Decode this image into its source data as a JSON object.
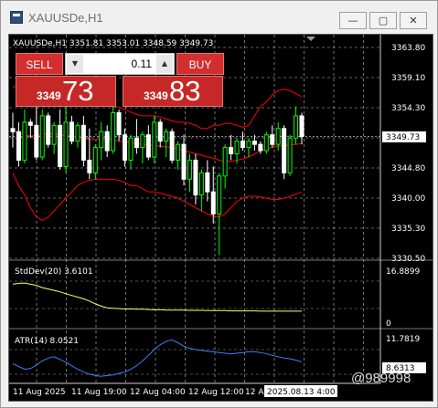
{
  "window": {
    "title": "XAUUSDe,H1",
    "min_glyph": "—",
    "max_glyph": "▢",
    "close_glyph": "✕"
  },
  "chart_header": "XAUUSDe,H1  3351.81 3353.01 3348.59 3349.73",
  "trade_panel": {
    "sell_label": "SELL",
    "buy_label": "BUY",
    "lot_value": "0.11",
    "bid_prefix": "3349",
    "bid_big": "73",
    "ask_prefix": "3349",
    "ask_big": "83"
  },
  "price_axis": [
    "3363.80",
    "3359.10",
    "3354.30",
    "3349.60",
    "3344.80",
    "3340.00",
    "3335.30",
    "3330.50"
  ],
  "current_price": "3349.73",
  "stddev": {
    "label": "StdDev(20) 3.6101",
    "max_label": "16.8899",
    "min_label": "0"
  },
  "atr": {
    "label": "ATR(14) 8.0521",
    "max_label": "11.7819",
    "current_label": "8.6313"
  },
  "time_axis": [
    "11 Aug 2025",
    "11 Aug 19:00",
    "12 Aug 04:00",
    "12 Aug 12:00",
    "12 Aug 20:00"
  ],
  "time_cursor_label": "2025.08.13 4:00",
  "watermark": "@989998",
  "colors": {
    "bull": "#00ff00",
    "bear": "#ffffff",
    "band": "#ff0000",
    "stddev": "#ffff66",
    "atr": "#3b82f6",
    "grid": "#ffffff",
    "panel_red": "#d32f2f"
  },
  "chart_data": {
    "type": "candlestick",
    "title": "XAUUSDe,H1",
    "ylim": [
      3330.5,
      3363.8
    ],
    "ohlc": [
      [
        3351.0,
        3353.5,
        3348.0,
        3350.5
      ],
      [
        3350.5,
        3352.0,
        3345.0,
        3346.0
      ],
      [
        3346.0,
        3354.0,
        3345.5,
        3352.0
      ],
      [
        3352.0,
        3352.5,
        3349.5,
        3351.5
      ],
      [
        3351.5,
        3355.0,
        3346.0,
        3346.5
      ],
      [
        3346.5,
        3354.0,
        3346.0,
        3353.0
      ],
      [
        3353.0,
        3353.5,
        3348.0,
        3348.5
      ],
      [
        3348.5,
        3352.0,
        3347.0,
        3351.5
      ],
      [
        3351.5,
        3354.0,
        3344.5,
        3345.0
      ],
      [
        3345.0,
        3354.5,
        3344.0,
        3352.0
      ],
      [
        3352.0,
        3353.0,
        3348.5,
        3349.0
      ],
      [
        3349.0,
        3352.0,
        3348.0,
        3351.5
      ],
      [
        3351.5,
        3353.0,
        3345.0,
        3346.0
      ],
      [
        3346.0,
        3351.0,
        3343.0,
        3344.0
      ],
      [
        3344.0,
        3348.5,
        3343.0,
        3348.0
      ],
      [
        3348.0,
        3352.0,
        3346.0,
        3350.5
      ],
      [
        3350.5,
        3351.5,
        3346.5,
        3347.5
      ],
      [
        3347.5,
        3354.5,
        3347.0,
        3353.5
      ],
      [
        3353.5,
        3354.0,
        3349.0,
        3350.0
      ],
      [
        3350.0,
        3351.0,
        3345.0,
        3346.0
      ],
      [
        3346.0,
        3350.0,
        3344.5,
        3349.5
      ],
      [
        3349.5,
        3352.5,
        3347.0,
        3348.0
      ],
      [
        3348.0,
        3350.5,
        3345.5,
        3350.0
      ],
      [
        3350.0,
        3351.5,
        3346.0,
        3346.5
      ],
      [
        3346.5,
        3353.0,
        3345.5,
        3352.0
      ],
      [
        3352.0,
        3352.5,
        3348.0,
        3349.0
      ],
      [
        3349.0,
        3351.0,
        3346.5,
        3350.5
      ],
      [
        3350.5,
        3351.0,
        3345.5,
        3346.0
      ],
      [
        3346.0,
        3349.0,
        3344.5,
        3348.5
      ],
      [
        3348.5,
        3350.0,
        3342.0,
        3343.0
      ],
      [
        3343.0,
        3347.0,
        3341.0,
        3346.0
      ],
      [
        3346.0,
        3347.0,
        3339.0,
        3340.5
      ],
      [
        3340.5,
        3344.5,
        3338.0,
        3344.0
      ],
      [
        3344.0,
        3346.0,
        3339.5,
        3341.0
      ],
      [
        3341.0,
        3345.0,
        3336.0,
        3337.5
      ],
      [
        3337.5,
        3344.0,
        3331.0,
        3343.5
      ],
      [
        3343.5,
        3348.5,
        3341.5,
        3348.0
      ],
      [
        3348.0,
        3350.0,
        3346.0,
        3347.0
      ],
      [
        3347.0,
        3349.5,
        3345.5,
        3349.0
      ],
      [
        3349.0,
        3350.5,
        3347.5,
        3348.0
      ],
      [
        3348.0,
        3349.5,
        3346.5,
        3349.0
      ],
      [
        3349.0,
        3350.0,
        3347.5,
        3348.5
      ],
      [
        3348.5,
        3349.0,
        3347.0,
        3347.5
      ],
      [
        3347.5,
        3350.5,
        3347.0,
        3350.0
      ],
      [
        3350.0,
        3351.5,
        3348.0,
        3348.5
      ],
      [
        3348.5,
        3352.0,
        3347.5,
        3351.0
      ],
      [
        3351.0,
        3351.5,
        3343.0,
        3344.0
      ],
      [
        3344.0,
        3350.0,
        3343.5,
        3349.5
      ],
      [
        3349.5,
        3354.5,
        3348.5,
        3353.0
      ],
      [
        3353.0,
        3353.5,
        3348.5,
        3349.73
      ]
    ],
    "bands": {
      "upper": [
        3357.5,
        3357.8,
        3358.2,
        3358.0,
        3357.8,
        3357.6,
        3357.5,
        3357.2,
        3357.0,
        3356.8,
        3356.5,
        3356.3,
        3356.0,
        3355.8,
        3355.5,
        3355.0,
        3354.5,
        3354.5,
        3354.4,
        3354.0,
        3353.6,
        3353.2,
        3353.0,
        3353.0,
        3353.0,
        3352.8,
        3352.5,
        3352.2,
        3352.0,
        3352.0,
        3351.8,
        3351.5,
        3351.0,
        3351.0,
        3351.5,
        3351.5,
        3351.8,
        3351.8,
        3351.5,
        3351.2,
        3351.5,
        3353.0,
        3354.5,
        3355.2,
        3356.3,
        3357.0,
        3357.2,
        3357.0,
        3356.5,
        3356.0
      ],
      "middle": [
        3350.5,
        3350.3,
        3350.0,
        3349.8,
        3349.9,
        3350.0,
        3350.2,
        3350.1,
        3350.0,
        3349.9,
        3349.8,
        3349.7,
        3349.5,
        3349.3,
        3349.2,
        3349.3,
        3349.3,
        3349.2,
        3349.0,
        3348.9,
        3348.8,
        3348.6,
        3348.5,
        3348.4,
        3348.3,
        3348.2,
        3348.1,
        3348.0,
        3347.8,
        3347.5,
        3347.3,
        3347.0,
        3346.8,
        3346.5,
        3346.3,
        3346.0,
        3345.8,
        3345.8,
        3346.0,
        3346.2,
        3346.5,
        3347.0,
        3347.5,
        3347.8,
        3348.0,
        3348.2,
        3348.3,
        3348.4,
        3348.5,
        3348.6
      ],
      "lower": [
        3344.0,
        3342.0,
        3340.5,
        3338.5,
        3337.0,
        3336.5,
        3337.0,
        3338.0,
        3339.0,
        3340.0,
        3341.0,
        3342.0,
        3342.5,
        3342.8,
        3343.0,
        3343.0,
        3343.0,
        3343.0,
        3342.8,
        3342.5,
        3342.0,
        3342.0,
        3341.5,
        3341.0,
        3341.0,
        3340.8,
        3340.5,
        3340.3,
        3340.0,
        3339.5,
        3339.0,
        3338.5,
        3338.0,
        3337.5,
        3337.2,
        3337.0,
        3337.5,
        3338.5,
        3339.5,
        3340.0,
        3340.3,
        3340.3,
        3340.2,
        3340.0,
        3339.8,
        3339.8,
        3340.0,
        3340.3,
        3340.6,
        3341.0
      ]
    },
    "stddev_series": {
      "name": "StdDev(20)",
      "ylim": [
        0,
        16.8899
      ],
      "values": [
        13.2,
        13.5,
        13.6,
        13.2,
        12.8,
        12.0,
        11.5,
        11.0,
        10.5,
        9.8,
        9.2,
        8.6,
        8.0,
        7.2,
        6.2,
        5.4,
        4.8,
        4.6,
        4.5,
        4.4,
        4.4,
        4.3,
        4.3,
        4.2,
        4.1,
        4.1,
        4.0,
        4.0,
        4.0,
        4.0,
        3.9,
        3.9,
        3.9,
        3.8,
        3.8,
        3.8,
        3.8,
        3.7,
        3.7,
        3.7,
        3.7,
        3.7,
        3.6,
        3.6,
        3.6,
        3.6,
        3.6,
        3.6,
        3.6,
        3.61
      ]
    },
    "atr_series": {
      "name": "ATR(14)",
      "ylim": [
        5.5,
        11.7819
      ],
      "values": [
        7.8,
        7.4,
        7.0,
        7.1,
        7.6,
        8.2,
        8.6,
        8.8,
        8.4,
        8.0,
        7.5,
        7.0,
        6.6,
        6.3,
        6.1,
        6.0,
        6.1,
        6.2,
        6.4,
        6.6,
        7.0,
        7.5,
        8.2,
        9.0,
        9.8,
        10.5,
        11.0,
        11.2,
        10.8,
        10.3,
        10.0,
        9.8,
        9.7,
        9.6,
        9.5,
        9.4,
        9.3,
        9.2,
        9.3,
        9.4,
        9.5,
        9.5,
        9.4,
        9.2,
        9.0,
        8.8,
        8.6,
        8.5,
        8.3,
        8.05
      ]
    }
  }
}
